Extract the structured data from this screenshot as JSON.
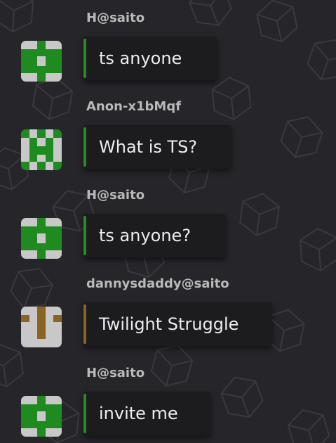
{
  "theme": {
    "background": "#262529",
    "bubble_background": "#1c1c1f",
    "sender_color": "#b9b9b9",
    "message_color": "#ededed"
  },
  "messages": [
    {
      "sender": "H@saito",
      "text": "ts anyone",
      "avatar": "green-identicon",
      "accent_color": "#2a8a24"
    },
    {
      "sender": "Anon-x1bMqf",
      "text": "What is TS?",
      "avatar": "green-identicon",
      "accent_color": "#2a8a24"
    },
    {
      "sender": "H@saito",
      "text": "ts anyone?",
      "avatar": "green-identicon",
      "accent_color": "#2a8a24"
    },
    {
      "sender": "dannysdaddy@saito",
      "text": "Twilight Struggle",
      "avatar": "brown-identicon",
      "accent_color": "#8a6424"
    },
    {
      "sender": "H@saito",
      "text": "invite me",
      "avatar": "green-identicon",
      "accent_color": "#2a8a24"
    }
  ]
}
